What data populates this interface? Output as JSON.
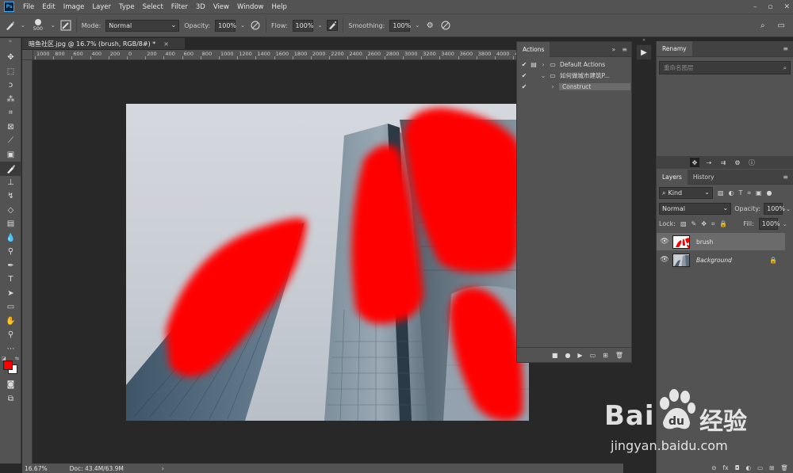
{
  "app": {
    "logo": "Ps"
  },
  "menu": [
    "File",
    "Edit",
    "Image",
    "Layer",
    "Type",
    "Select",
    "Filter",
    "3D",
    "View",
    "Window",
    "Help"
  ],
  "window_controls": [
    "–",
    "▫",
    "✕"
  ],
  "options": {
    "brush_size": "500",
    "mode_label": "Mode:",
    "mode_value": "Normal",
    "opacity_label": "Opacity:",
    "opacity_value": "100%",
    "flow_label": "Flow:",
    "flow_value": "100%",
    "smoothing_label": "Smoothing:",
    "smoothing_value": "100%"
  },
  "document_tab": {
    "title": "暗鱼社区.jpg @ 16.7% (brush, RGB/8#) *",
    "close": "×"
  },
  "ruler": {
    "h_labels": [
      "1000",
      "800",
      "600",
      "400",
      "200",
      "0",
      "200",
      "400",
      "600",
      "800",
      "1000",
      "1200",
      "1400",
      "1600",
      "1800",
      "2000",
      "2200",
      "2400",
      "2600",
      "2800",
      "3000",
      "3200",
      "3400",
      "3600",
      "3800",
      "4000",
      "42"
    ]
  },
  "status": {
    "zoom": "16.67%",
    "doc": "Doc: 43.4M/63.9M",
    "arrow": "›"
  },
  "actions_panel": {
    "tab": "Actions",
    "rows": [
      {
        "label": "Default Actions",
        "indent": 0,
        "type": "folder"
      },
      {
        "label": "如何做城市建筑P...",
        "indent": 0,
        "type": "folder-open"
      },
      {
        "label": "Construct",
        "indent": 1,
        "type": "action"
      }
    ]
  },
  "rename_panel": {
    "tab": "Renamy",
    "search_placeholder": "重命名图层"
  },
  "layers_panel": {
    "tabs": [
      "Layers",
      "History"
    ],
    "kind": "Kind",
    "blend_mode": "Normal",
    "opacity_label": "Opacity:",
    "opacity_value": "100%",
    "lock_label": "Lock:",
    "fill_label": "Fill:",
    "fill_value": "100%",
    "layers": [
      {
        "name": "brush",
        "italic": false,
        "selected": true,
        "locked": false
      },
      {
        "name": "Background",
        "italic": true,
        "selected": false,
        "locked": true
      }
    ],
    "footer": [
      "⊝",
      "fx",
      "◘",
      "◐",
      "▭",
      "⊞",
      "🗑"
    ]
  },
  "watermark": {
    "brand_top": "Bai",
    "brand_cn": "经验",
    "url": "jingyan.baidu.com"
  },
  "colors": {
    "foreground": "#ff0000",
    "background": "#ffffff",
    "brush_paint": "#ff0000"
  }
}
